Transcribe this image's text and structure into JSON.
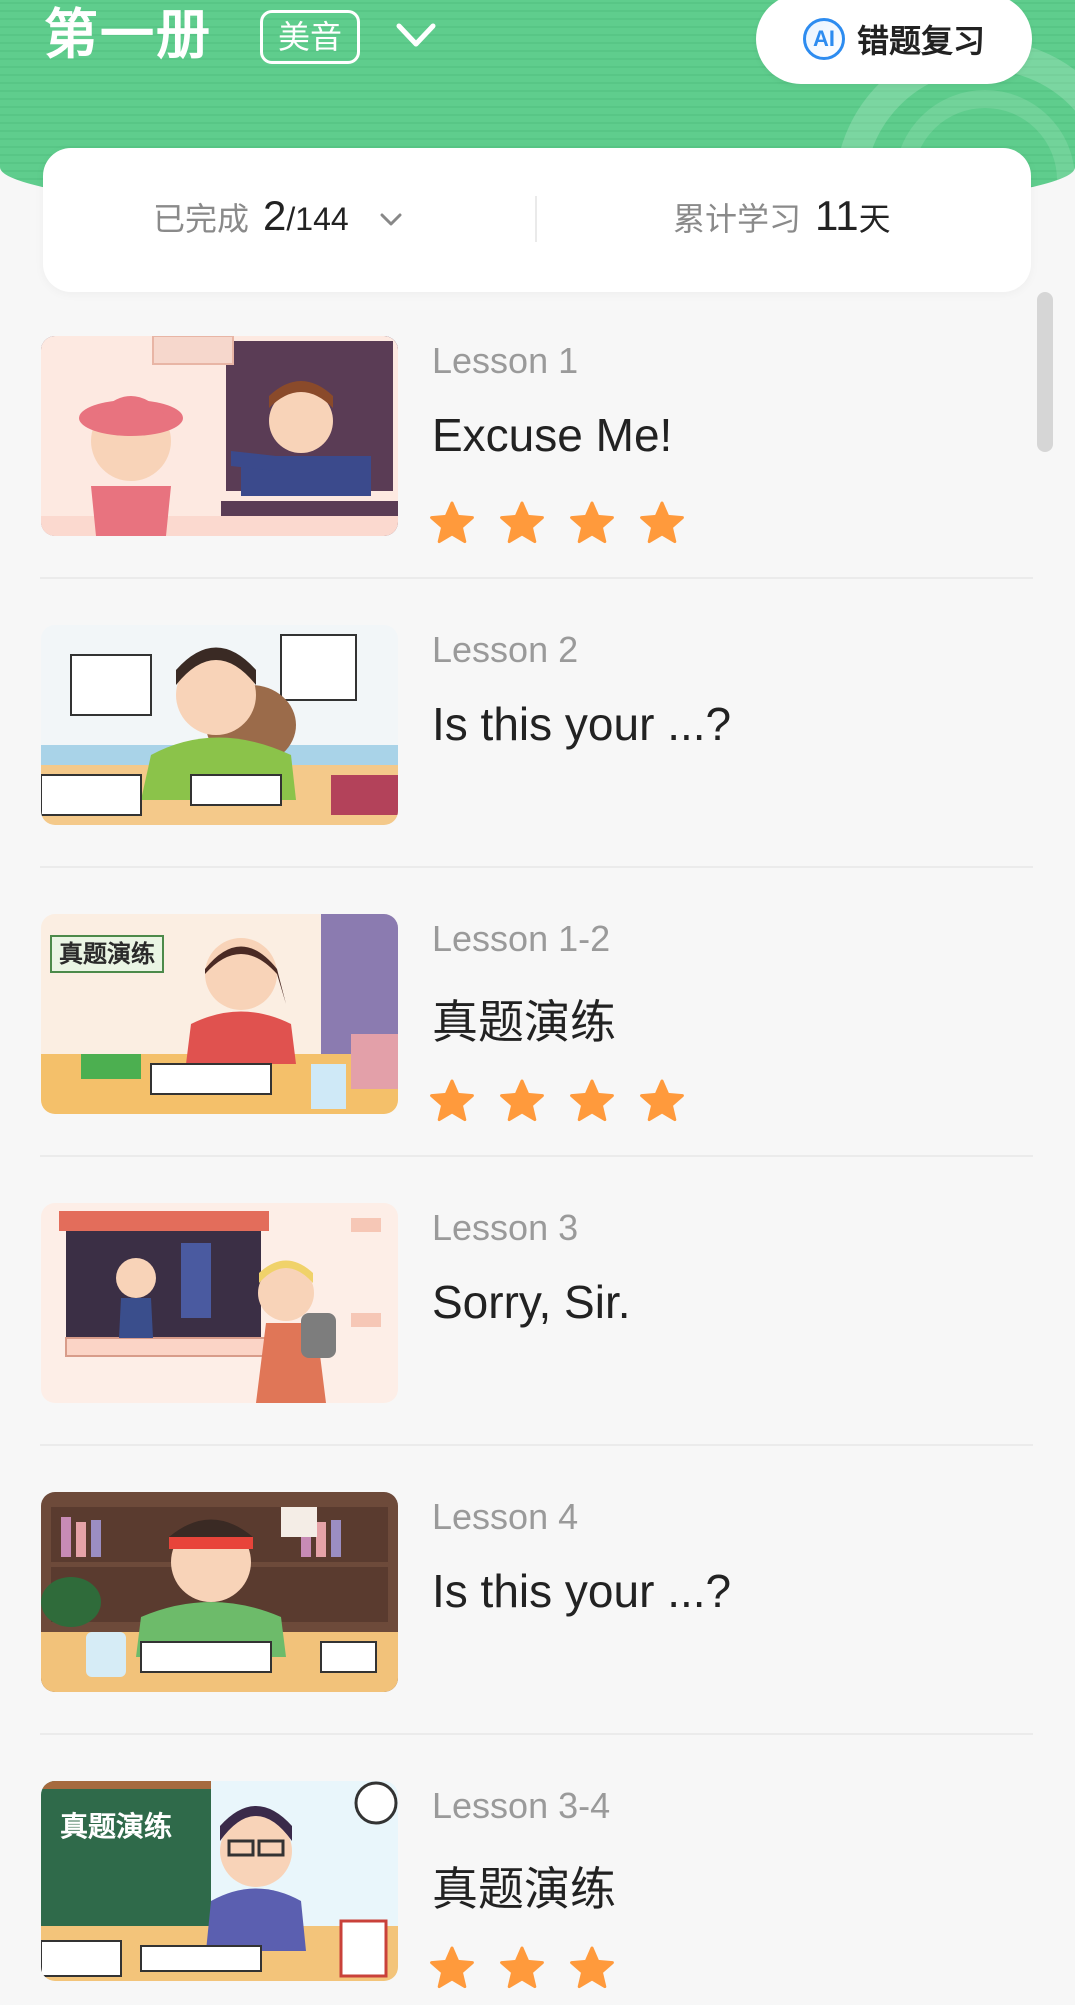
{
  "header": {
    "book_title": "第一册",
    "accent_badge": "美音",
    "ai_review": {
      "icon_text": "AI",
      "label": "错题复习"
    }
  },
  "stats": {
    "completed_label": "已完成",
    "completed_value": "2",
    "completed_total": "/144",
    "days_label": "累计学习",
    "days_value": "11",
    "days_unit": "天"
  },
  "colors": {
    "header_green": "#5fcd8d",
    "star_orange": "#ff9a3c",
    "ai_blue": "#2d8cf0"
  },
  "lessons": [
    {
      "num": "Lesson 1",
      "title": "Excuse Me!",
      "stars": 4,
      "thumb": "classroom-greeting"
    },
    {
      "num": "Lesson 2",
      "title": "Is this your ...?",
      "stars": 0,
      "thumb": "boy-writing-desk"
    },
    {
      "num": "Lesson 1-2",
      "title": "真题演练",
      "stars": 4,
      "thumb": "practice-girl",
      "thumb_text": "真题演练"
    },
    {
      "num": "Lesson 3",
      "title": "Sorry, Sir.",
      "stars": 0,
      "thumb": "cloakroom-counter"
    },
    {
      "num": "Lesson 4",
      "title": "Is this your ...?",
      "stars": 0,
      "thumb": "boy-headband-study"
    },
    {
      "num": "Lesson 3-4",
      "title": "真题演练",
      "stars": 3,
      "thumb": "practice-boy-blackboard",
      "thumb_text": "真题演练"
    }
  ]
}
